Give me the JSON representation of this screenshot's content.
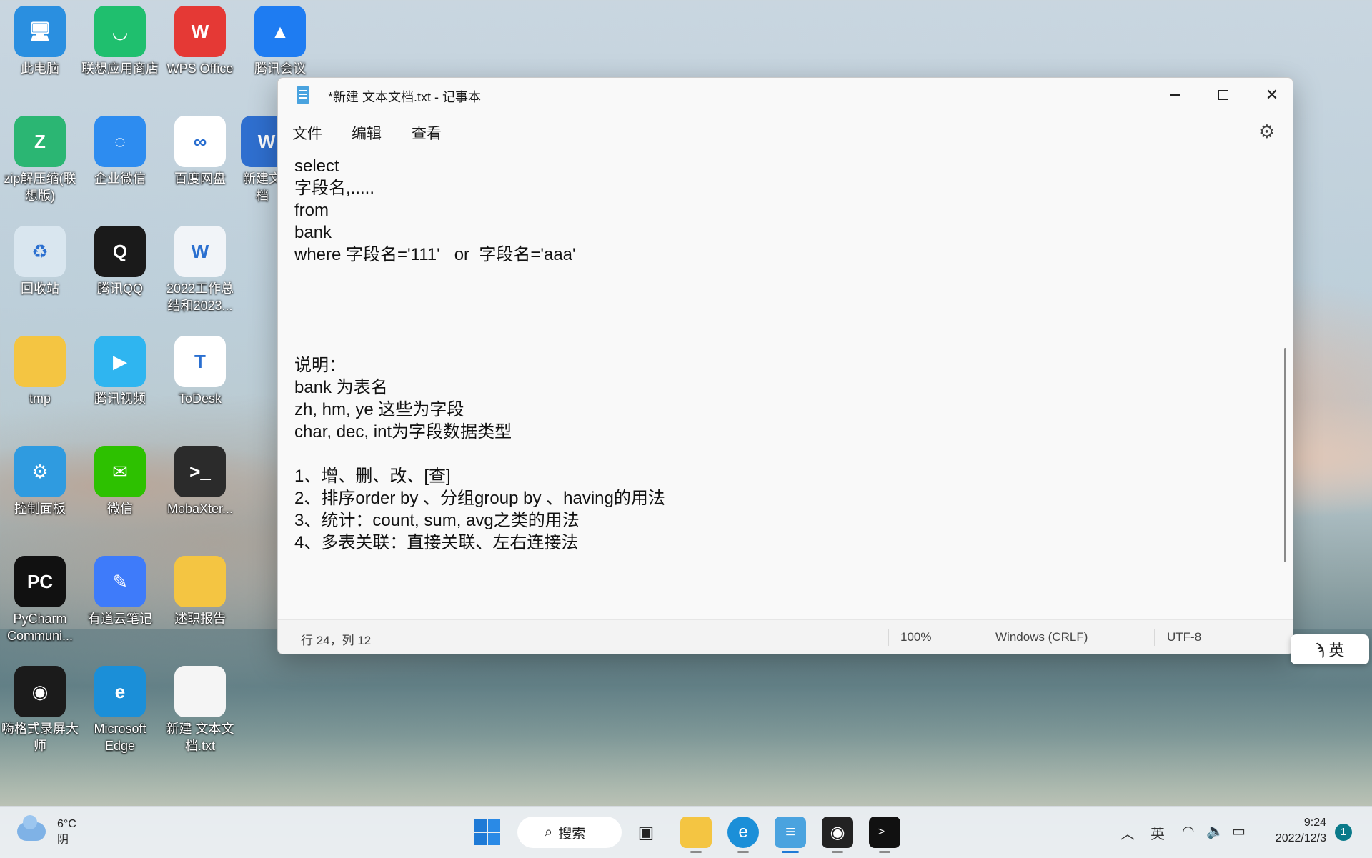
{
  "desktop": {
    "icons": [
      {
        "name": "this-pc",
        "label": "此电脑",
        "color": "#2a8fe0",
        "glyph": "🖥"
      },
      {
        "name": "lenovo-app-store",
        "label": "联想应用商店",
        "color": "#1fbf6e",
        "glyph": "◡"
      },
      {
        "name": "wps-office",
        "label": "WPS Office",
        "color": "#e53935",
        "glyph": "W"
      },
      {
        "name": "tencent-meeting",
        "label": "腾讯会议",
        "color": "#1e7cf2",
        "glyph": "▲"
      },
      {
        "name": "zip-tool",
        "label": "zip解压缩(联想版)",
        "color": "#2bb673",
        "glyph": "Z"
      },
      {
        "name": "wecom",
        "label": "企业微信",
        "color": "#2d8cf0",
        "glyph": "◌"
      },
      {
        "name": "baidu-netdisk",
        "label": "百度网盘",
        "color": "#ffffff",
        "glyph": "∞"
      },
      {
        "name": "new-doc",
        "label": "新建文档",
        "color": "#2f6fcf",
        "glyph": "W"
      },
      {
        "name": "recycle-bin",
        "label": "回收站",
        "color": "#d9e6ef",
        "glyph": "♻"
      },
      {
        "name": "tencent-qq",
        "label": "腾讯QQ",
        "color": "#1a1a1a",
        "glyph": "Q"
      },
      {
        "name": "work-summary-doc",
        "label": "2022工作总结和2023...",
        "color": "#f1f4f8",
        "glyph": "W"
      },
      {
        "name": "tmp-folder",
        "label": "tmp",
        "color": "#f4c542",
        "glyph": ""
      },
      {
        "name": "tencent-video",
        "label": "腾讯视频",
        "color": "#2fb5f0",
        "glyph": "▶"
      },
      {
        "name": "todesk",
        "label": "ToDesk",
        "color": "#ffffff",
        "glyph": "T"
      },
      {
        "name": "control-panel",
        "label": "控制面板",
        "color": "#2f9be0",
        "glyph": "⚙"
      },
      {
        "name": "wechat",
        "label": "微信",
        "color": "#2dc100",
        "glyph": "✉"
      },
      {
        "name": "mobaxterm",
        "label": "MobaXter...",
        "color": "#2b2b2b",
        "glyph": ">_"
      },
      {
        "name": "pycharm",
        "label": "PyCharm Communi...",
        "color": "#111111",
        "glyph": "PC"
      },
      {
        "name": "youdao-note",
        "label": "有道云笔记",
        "color": "#3e7bfa",
        "glyph": "✎"
      },
      {
        "name": "report-folder",
        "label": "述职报告",
        "color": "#f4c542",
        "glyph": ""
      },
      {
        "name": "screen-recorder",
        "label": "嗨格式录屏大师",
        "color": "#1b1b1b",
        "glyph": "◉"
      },
      {
        "name": "microsoft-edge",
        "label": "Microsoft Edge",
        "color": "#1b8fd8",
        "glyph": "e"
      },
      {
        "name": "new-txt-file",
        "label": "新建 文本文档.txt",
        "color": "#f5f5f5",
        "glyph": ""
      }
    ]
  },
  "notepad": {
    "title": "*新建 文本文档.txt - 记事本",
    "menu": {
      "file": "文件",
      "edit": "编辑",
      "view": "查看"
    },
    "content": "select\n字段名,.....\nfrom\nbank\nwhere 字段名='111'   or  字段名='aaa'\n\n\n\n\n说明：\nbank 为表名\nzh, hm, ye 这些为字段\nchar, dec, int为字段数据类型\n\n1、增、删、改、[查]\n2、排序order by 、分组group by 、having的用法\n3、统计：count, sum, avg之类的用法\n4、多表关联：直接关联、左右连接法",
    "status": {
      "position": "行 24，列 12",
      "zoom": "100%",
      "line_ending": "Windows (CRLF)",
      "encoding": "UTF-8"
    }
  },
  "ime": {
    "label": "英"
  },
  "taskbar": {
    "weather": {
      "temp": "6°C",
      "condition": "阴"
    },
    "search_label": "搜索",
    "tray": {
      "ime": "英"
    },
    "clock": {
      "time": "9:24",
      "date": "2022/12/3"
    },
    "notifications": "1"
  }
}
